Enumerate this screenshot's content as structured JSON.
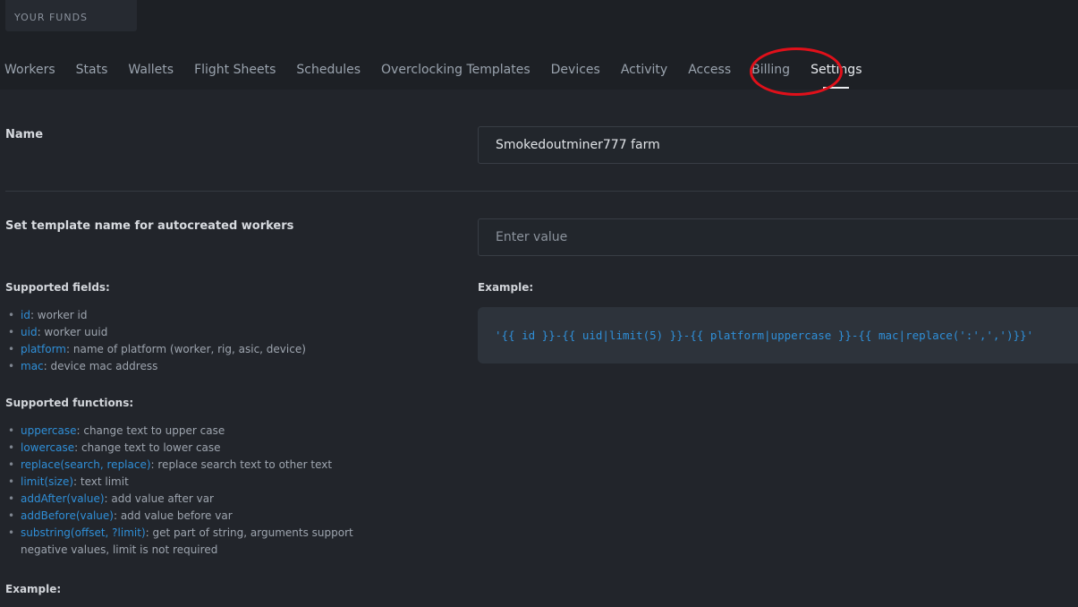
{
  "header": {
    "funds_label": "YOUR FUNDS"
  },
  "tabs": [
    {
      "label": "Workers"
    },
    {
      "label": "Stats"
    },
    {
      "label": "Wallets"
    },
    {
      "label": "Flight Sheets"
    },
    {
      "label": "Schedules"
    },
    {
      "label": "Overclocking Templates"
    },
    {
      "label": "Devices"
    },
    {
      "label": "Activity"
    },
    {
      "label": "Access"
    },
    {
      "label": "Billing"
    },
    {
      "label": "Settings",
      "active": true
    }
  ],
  "annotation_color": "#e0101a",
  "settings": {
    "name_label": "Name",
    "name_value": "Smokedoutminer777 farm",
    "template_label": "Set template name for autocreated workers",
    "template_placeholder": "Enter value",
    "fields_title": "Supported fields:",
    "fields": [
      {
        "key": "id",
        "desc": ": worker id"
      },
      {
        "key": "uid",
        "desc": ": worker uuid"
      },
      {
        "key": "platform",
        "desc": ": name of platform (worker, rig, asic, device)"
      },
      {
        "key": "mac",
        "desc": ": device mac address"
      }
    ],
    "functions_title": "Supported functions:",
    "functions": [
      {
        "key": "uppercase",
        "desc": ": change text to upper case"
      },
      {
        "key": "lowercase",
        "desc": ": change text to lower case"
      },
      {
        "key": "replace(search, replace)",
        "desc": ": replace search text to other text"
      },
      {
        "key": "limit(size)",
        "desc": ": text limit"
      },
      {
        "key": "addAfter(value)",
        "desc": ": add value after var"
      },
      {
        "key": "addBefore(value)",
        "desc": ": add value before var"
      },
      {
        "key": "substring(offset, ?limit)",
        "desc": ": get part of string, arguments support negative values, limit is not required"
      }
    ],
    "example_label_right": "Example:",
    "example_code": "'{{ id }}-{{ uid|limit(5) }}-{{ platform|uppercase }}-{{ mac|replace(':',',')}}'",
    "example_label_bottom": "Example:"
  }
}
